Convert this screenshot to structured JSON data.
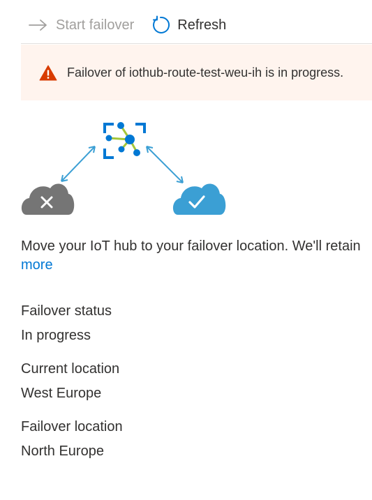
{
  "toolbar": {
    "start_failover_label": "Start failover",
    "refresh_label": "Refresh"
  },
  "banner": {
    "message": "Failover of iothub-route-test-weu-ih is in progress."
  },
  "description": {
    "text": "Move your IoT hub to your failover location. We'll retain",
    "learn_more": "more"
  },
  "fields": [
    {
      "label": "Failover status",
      "value": "In progress"
    },
    {
      "label": "Current location",
      "value": "West Europe"
    },
    {
      "label": "Failover location",
      "value": "North Europe"
    }
  ],
  "colors": {
    "accent": "#0078d4",
    "warning": "#d83b01",
    "banner_bg": "#fff4ee",
    "primary_cloud": "#8a8886",
    "secondary_cloud": "#3b9fd4"
  },
  "icons": {
    "start_failover": "arrow-right-icon",
    "refresh": "refresh-icon",
    "banner": "warning-icon",
    "hub": "iot-hub-icon",
    "failed_region": "cloud-error-icon",
    "healthy_region": "cloud-check-icon"
  }
}
